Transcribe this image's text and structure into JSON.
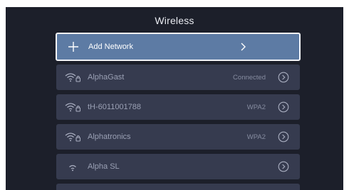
{
  "header": {
    "title": "Wireless"
  },
  "add_network": {
    "label": "Add Network",
    "icon": "plus-icon"
  },
  "networks": [
    {
      "name": "AlphaGast",
      "status": "Connected",
      "icon": "wifi-lock-icon"
    },
    {
      "name": "tH-6011001788",
      "status": "WPA2",
      "icon": "wifi-lock-icon"
    },
    {
      "name": "Alphatronics",
      "status": "WPA2",
      "icon": "wifi-lock-icon"
    },
    {
      "name": "Alpha SL",
      "status": "",
      "icon": "wifi-icon"
    }
  ],
  "colors": {
    "background": "#1c1f2a",
    "row": "#363b4f",
    "selected_row": "#5d7ba4",
    "selected_border": "#f2f4f8"
  }
}
